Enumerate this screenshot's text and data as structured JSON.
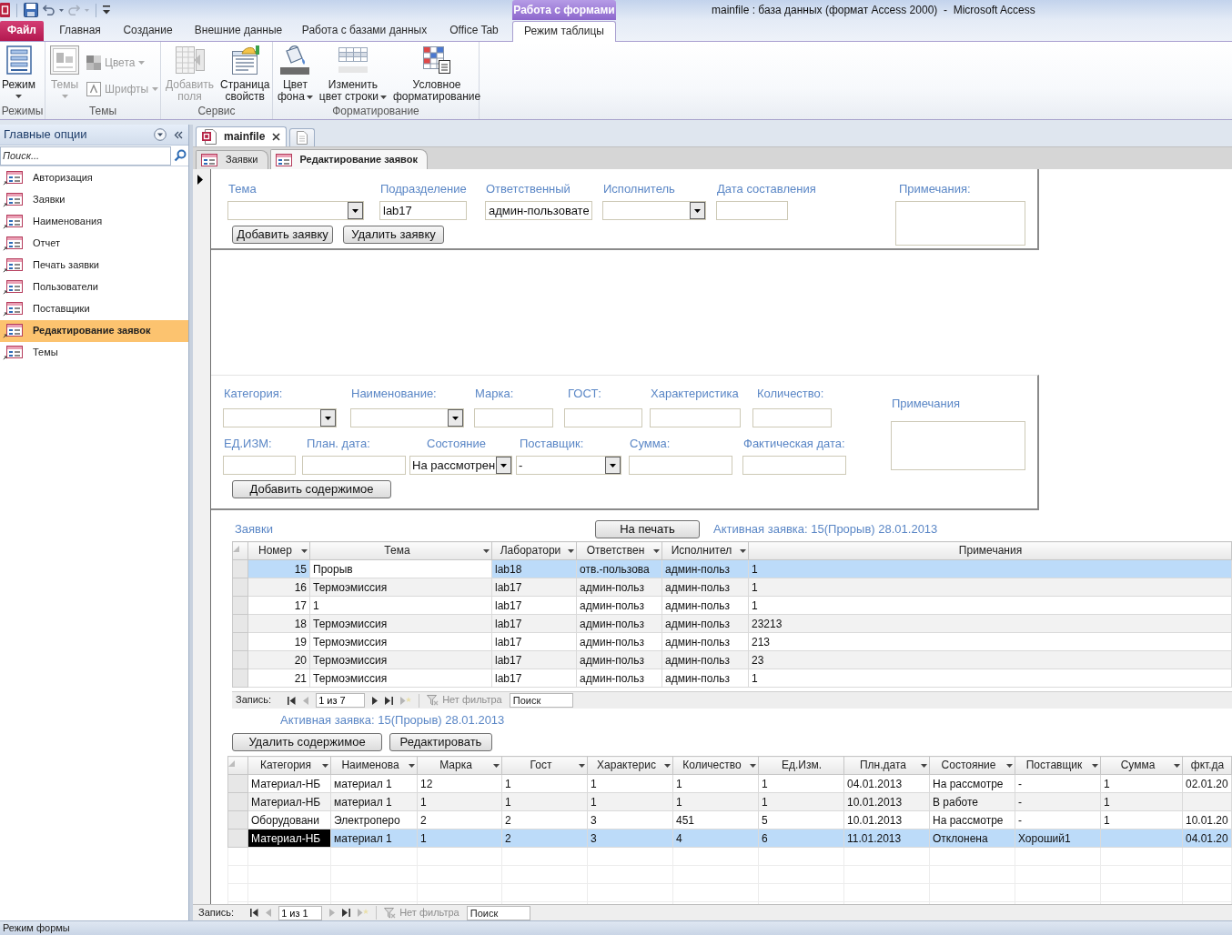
{
  "window": {
    "title": "mainfile : база данных (формат Access 2000)  -  Microsoft Access",
    "context_group": "Работа с формами"
  },
  "ribbon": {
    "tabs": [
      {
        "label": "Файл",
        "kind": "file",
        "selected": false
      },
      {
        "label": "Главная",
        "kind": "tab",
        "selected": false
      },
      {
        "label": "Создание",
        "kind": "tab",
        "selected": false
      },
      {
        "label": "Внешние данные",
        "kind": "tab",
        "selected": false
      },
      {
        "label": "Работа с базами данных",
        "kind": "tab",
        "selected": false
      },
      {
        "label": "Office Tab",
        "kind": "tab",
        "selected": false
      },
      {
        "label": "Режим таблицы",
        "kind": "context",
        "selected": true
      }
    ],
    "groups": [
      {
        "label": "Режимы",
        "commands": [
          {
            "label": "Режим",
            "kind": "large",
            "dropdown": true,
            "disabled": false
          }
        ]
      },
      {
        "label": "Темы",
        "commands": [
          {
            "label": "Темы",
            "kind": "large",
            "dropdown": true,
            "disabled": true
          },
          {
            "label": "Цвета",
            "kind": "small",
            "dropdown": true,
            "disabled": true
          },
          {
            "label": "Шрифты",
            "kind": "small",
            "dropdown": true,
            "disabled": true
          }
        ]
      },
      {
        "label": "Сервис",
        "commands": [
          {
            "label": "Добавить\nполя",
            "kind": "large",
            "dropdown": false,
            "disabled": true
          },
          {
            "label": "Страница\nсвойств",
            "kind": "large",
            "dropdown": false,
            "disabled": false
          }
        ]
      },
      {
        "label": "Форматирование",
        "commands": [
          {
            "label": "Цвет\nфона",
            "kind": "large",
            "dropdown": true,
            "disabled": false
          },
          {
            "label": "Изменить\nцвет строки",
            "kind": "large",
            "dropdown": true,
            "disabled": false
          },
          {
            "label": "Условное\nформатирование",
            "kind": "large",
            "dropdown": false,
            "disabled": false
          }
        ]
      }
    ]
  },
  "nav_pane": {
    "title": "Главные опции",
    "search": {
      "placeholder": "Поиск..."
    },
    "items": [
      {
        "label": "Авторизация",
        "selected": false
      },
      {
        "label": "Заявки",
        "selected": false
      },
      {
        "label": "Наименования",
        "selected": false
      },
      {
        "label": "Отчет",
        "selected": false
      },
      {
        "label": "Печать заявки",
        "selected": false
      },
      {
        "label": "Пользователи",
        "selected": false
      },
      {
        "label": "Поставщики",
        "selected": false
      },
      {
        "label": "Редактирование заявок",
        "selected": true
      },
      {
        "label": "Темы",
        "selected": false
      }
    ]
  },
  "document_tabs": [
    {
      "label": "mainfile",
      "kind": "database",
      "selected": true,
      "closable": true
    },
    {
      "kind": "blank",
      "selected": false,
      "closable": false
    }
  ],
  "object_tabs": [
    {
      "label": "Заявки",
      "selected": false
    },
    {
      "label": "Редактирование заявок",
      "selected": true
    }
  ],
  "form": {
    "request_section": {
      "fields": [
        {
          "label": "Тема",
          "kind": "combo"
        },
        {
          "label": "Подразделение",
          "kind": "text",
          "value": "lab17"
        },
        {
          "label": "Ответственный",
          "kind": "text",
          "value": "админ-пользовате"
        },
        {
          "label": "Исполнитель",
          "kind": "combo"
        },
        {
          "label": "Дата составления",
          "kind": "text"
        }
      ],
      "notes": {
        "label": "Примечания:"
      },
      "buttons": [
        "Добавить заявку",
        "Удалить заявку"
      ]
    },
    "content_section": {
      "rows": [
        [
          {
            "label": "Категория:",
            "kind": "combo"
          },
          {
            "label": "Наименование:",
            "kind": "combo"
          },
          {
            "label": "Марка:",
            "kind": "text"
          },
          {
            "label": "ГОСТ:",
            "kind": "text"
          },
          {
            "label": "Характеристика",
            "kind": "text"
          },
          {
            "label": "Количество:",
            "kind": "text"
          }
        ],
        [
          {
            "label": "ЕД.ИЗМ:",
            "kind": "text"
          },
          {
            "label": "План. дата:",
            "kind": "text"
          },
          {
            "label": "Состояние",
            "kind": "combo",
            "value": "На рассмотрен"
          },
          {
            "label": "Поставщик:",
            "kind": "combo",
            "value": "-"
          },
          {
            "label": "Сумма:",
            "kind": "text"
          },
          {
            "label": "Фактическая дата:",
            "kind": "text"
          }
        ]
      ],
      "notes": {
        "label": "Примечания"
      },
      "buttons": [
        "Добавить содержимое"
      ]
    },
    "requests": {
      "label": "Заявки",
      "print_button": "На печать",
      "active_request": "Активная заявка: 15(Прорыв) 28.01.2013",
      "table": {
        "columns": [
          {
            "label": "Номер",
            "kind": "number",
            "menu": true
          },
          {
            "label": "Тема",
            "kind": "text",
            "menu": true
          },
          {
            "label": "Лаборатори",
            "kind": "text",
            "menu": true
          },
          {
            "label": "Ответствен",
            "kind": "text",
            "menu": true
          },
          {
            "label": "Исполнител",
            "kind": "text",
            "menu": true
          },
          {
            "label": "Примечания",
            "kind": "text",
            "menu": false
          }
        ],
        "rows": [
          {
            "selected": true,
            "cells": [
              "15",
              {
                "text": "Прорыв",
                "focused": true
              },
              "lab18",
              "отв.-пользова",
              "админ-польз",
              "1"
            ]
          },
          {
            "selected": false,
            "cells": [
              "16",
              "Термоэмиссия",
              "lab17",
              "админ-польз",
              "админ-польз",
              "1"
            ]
          },
          {
            "selected": false,
            "cells": [
              "17",
              "1",
              "lab17",
              "админ-польз",
              "админ-польз",
              "1"
            ]
          },
          {
            "selected": false,
            "cells": [
              "18",
              "Термоэмиссия",
              "lab17",
              "админ-польз",
              "админ-польз",
              "23213"
            ]
          },
          {
            "selected": false,
            "cells": [
              "19",
              "Термоэмиссия",
              "lab17",
              "админ-польз",
              "админ-польз",
              "213"
            ]
          },
          {
            "selected": false,
            "cells": [
              "20",
              "Термоэмиссия",
              "lab17",
              "админ-польз",
              "админ-польз",
              "23"
            ]
          },
          {
            "selected": false,
            "cells": [
              "21",
              "Термоэмиссия",
              "lab17",
              "админ-польз",
              "админ-польз",
              "1"
            ]
          }
        ]
      },
      "navigation": {
        "label": "Запись:",
        "controls": [
          {
            "kind": "first",
            "disabled": false
          },
          {
            "kind": "previous",
            "disabled": true
          },
          {
            "kind": "position",
            "value": "1 из 7"
          },
          {
            "kind": "next",
            "disabled": false
          },
          {
            "kind": "last",
            "disabled": false
          },
          {
            "kind": "new",
            "disabled": true
          }
        ],
        "filter": {
          "label": "Нет фильтра",
          "disabled": true
        },
        "search": {
          "placeholder": "Поиск"
        }
      }
    },
    "items": {
      "active_request": "Активная заявка: 15(Прорыв) 28.01.2013",
      "buttons": [
        "Удалить содержимое",
        "Редактировать"
      ],
      "table": {
        "columns": [
          {
            "label": "Категория",
            "kind": "text",
            "menu": true
          },
          {
            "label": "Наименова",
            "kind": "text",
            "menu": true
          },
          {
            "label": "Марка",
            "kind": "text",
            "menu": true
          },
          {
            "label": "Гост",
            "kind": "text",
            "menu": true
          },
          {
            "label": "Характерис",
            "kind": "text",
            "menu": true
          },
          {
            "label": "Количество",
            "kind": "text",
            "menu": true
          },
          {
            "label": "Ед.Изм.",
            "kind": "text",
            "menu": false
          },
          {
            "label": "Плн.дата",
            "kind": "text",
            "menu": true
          },
          {
            "label": "Состояние",
            "kind": "text",
            "menu": true
          },
          {
            "label": "Поставщик",
            "kind": "text",
            "menu": true
          },
          {
            "label": "Сумма",
            "kind": "text",
            "menu": true
          },
          {
            "label": "фкт.да",
            "kind": "text",
            "menu": false
          }
        ],
        "rows": [
          {
            "selected": false,
            "cells": [
              "Материал-НБ",
              "материал 1",
              "12",
              "1",
              "1",
              "1",
              "1",
              "04.01.2013",
              "На рассмотре",
              "-",
              "1",
              "02.01.20"
            ]
          },
          {
            "selected": false,
            "cells": [
              "Материал-НБ",
              "материал 1",
              "1",
              "1",
              "1",
              "1",
              "1",
              "10.01.2013",
              "В работе",
              "-",
              "1",
              null
            ]
          },
          {
            "selected": false,
            "cells": [
              "Оборудовани",
              "Электроперо",
              "2",
              "2",
              "3",
              "451",
              "5",
              "10.01.2013",
              "На рассмотре",
              "-",
              "1",
              "10.01.20"
            ]
          },
          {
            "selected": true,
            "cells": [
              {
                "text": "Материал-НБ",
                "highlighted": true
              },
              "материал 1",
              "1",
              "2",
              "3",
              "4",
              "6",
              "11.01.2013",
              "Отклонена",
              "Хороший1",
              null,
              "04.01.20"
            ]
          }
        ]
      }
    },
    "navigation": {
      "label": "Запись:",
      "controls": [
        {
          "kind": "first",
          "disabled": false
        },
        {
          "kind": "previous",
          "disabled": true
        },
        {
          "kind": "position",
          "value": "1 из 1"
        },
        {
          "kind": "next",
          "disabled": true
        },
        {
          "kind": "last",
          "disabled": false
        },
        {
          "kind": "new",
          "disabled": true
        }
      ],
      "filter": {
        "label": "Нет фильтра",
        "disabled": true
      },
      "search": {
        "placeholder": "Поиск"
      }
    }
  },
  "status_bar": {
    "text": "Режим формы"
  }
}
